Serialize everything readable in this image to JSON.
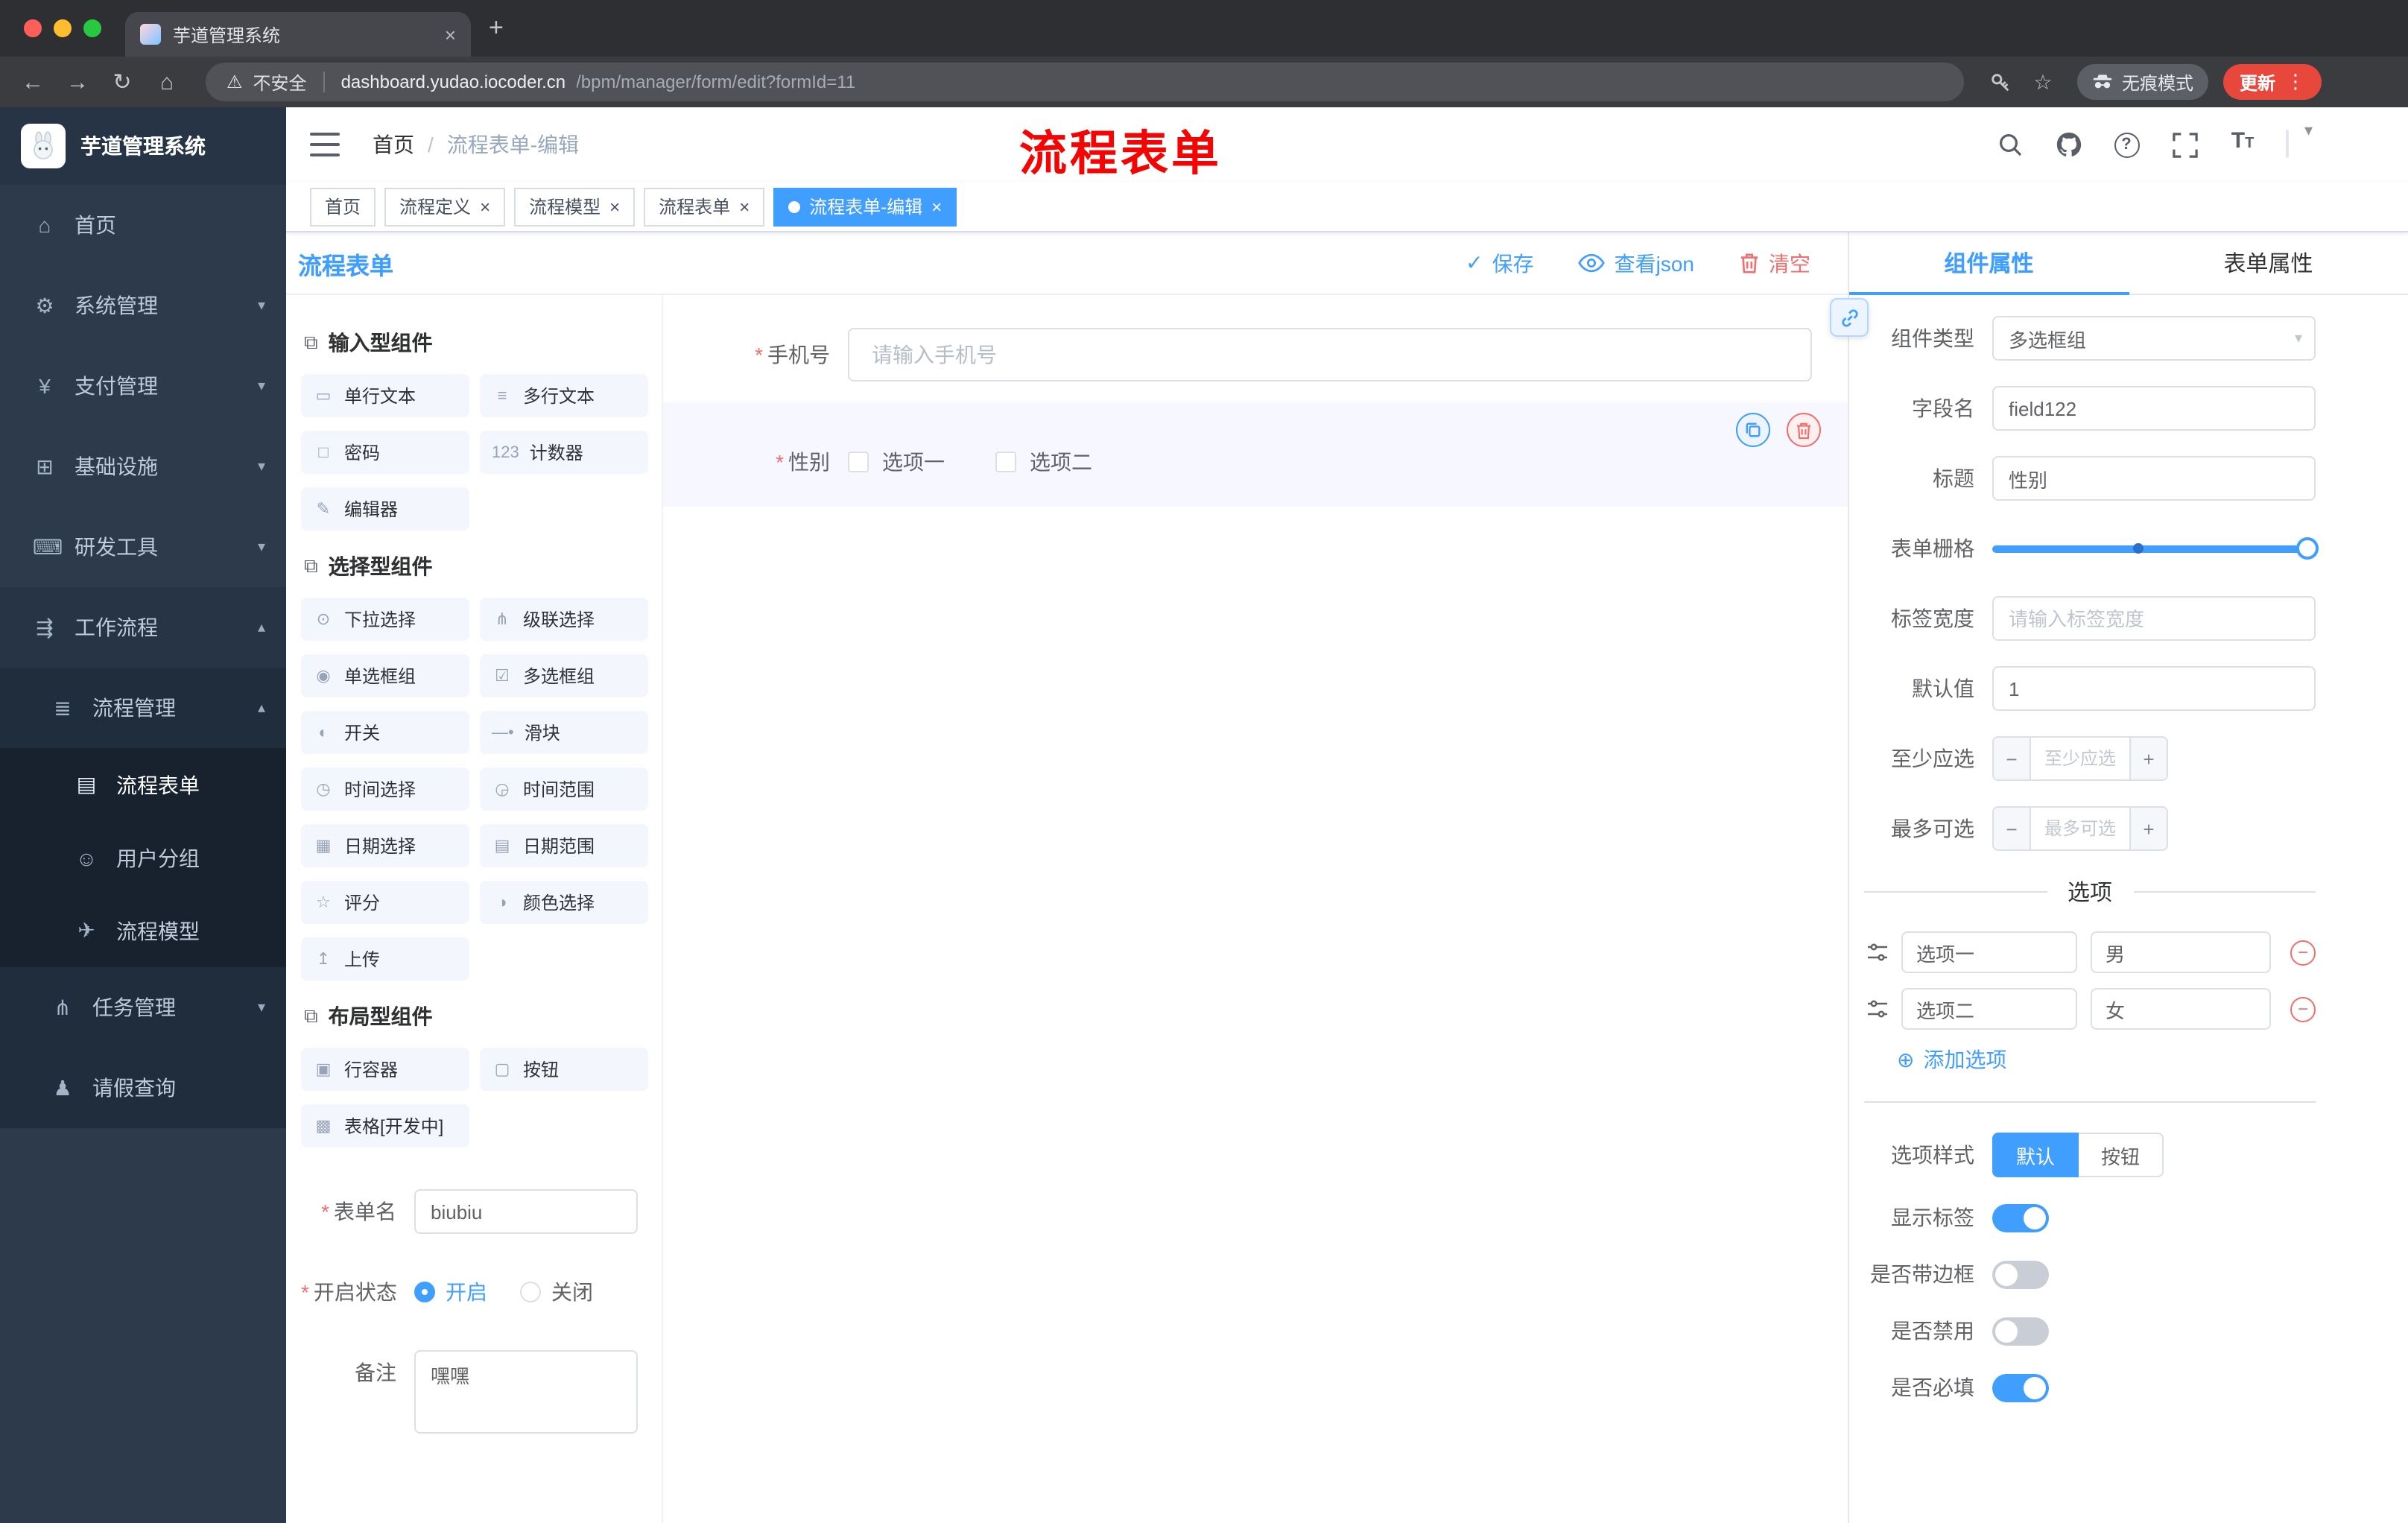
{
  "colors": {
    "primary": "#409eff",
    "danger": "#f56c6c",
    "annotation": "#f40402",
    "sidebar": "#2d3a4b"
  },
  "icons": {
    "close": "×",
    "new_tab": "+",
    "warning": "⚠",
    "back": "←",
    "forward": "→",
    "reload": "↻",
    "home": "⌂",
    "star": "☆",
    "menu_dots": "⋮",
    "caret_down": "▾",
    "caret_up": "▴",
    "check": "✓",
    "circle_plus": "⊕",
    "minus": "−",
    "plus": "+",
    "question": "?",
    "font_size": "T",
    "font_size_small": "T",
    "section": "⧉",
    "dot": "•"
  },
  "browser": {
    "tab_title": "芋道管理系统",
    "security_label": "不安全",
    "url_domain": "dashboard.yudao.iocoder.cn",
    "url_path": "/bpm/manager/form/edit?formId=11",
    "incognito_label": "无痕模式",
    "update_label": "更新"
  },
  "sidebar": {
    "logo_title": "芋道管理系统",
    "items": [
      {
        "label": "首页",
        "icon": "⌂"
      },
      {
        "label": "系统管理",
        "icon": "⚙"
      },
      {
        "label": "支付管理",
        "icon": "¥"
      },
      {
        "label": "基础设施",
        "icon": "⊞"
      },
      {
        "label": "研发工具",
        "icon": "⌨"
      },
      {
        "label": "工作流程",
        "icon": "⇶"
      },
      {
        "label": "流程管理",
        "icon": "≣"
      },
      {
        "label": "流程表单",
        "icon": "▤"
      },
      {
        "label": "用户分组",
        "icon": "☺"
      },
      {
        "label": "流程模型",
        "icon": "✈"
      },
      {
        "label": "任务管理",
        "icon": "⋔"
      },
      {
        "label": "请假查询",
        "icon": "♟"
      }
    ]
  },
  "header": {
    "breadcrumb_home": "首页",
    "breadcrumb_sep": "/",
    "breadcrumb_current": "流程表单-编辑",
    "annotation": "流程表单"
  },
  "tags": [
    {
      "label": "首页"
    },
    {
      "label": "流程定义"
    },
    {
      "label": "流程模型"
    },
    {
      "label": "流程表单"
    },
    {
      "label": "流程表单-编辑"
    }
  ],
  "designer": {
    "title": "流程表单",
    "actions": {
      "save": "保存",
      "view_json": "查看json",
      "clear": "清空"
    },
    "palette": {
      "sections": [
        {
          "title": "输入型组件",
          "items": [
            {
              "label": "单行文本",
              "icon": "▭"
            },
            {
              "label": "多行文本",
              "icon": "≡"
            },
            {
              "label": "密码",
              "icon": "□"
            },
            {
              "label": "计数器",
              "icon": "123"
            },
            {
              "label": "编辑器",
              "icon": "✎"
            }
          ]
        },
        {
          "title": "选择型组件",
          "items": [
            {
              "label": "下拉选择",
              "icon": "⊙"
            },
            {
              "label": "级联选择",
              "icon": "⋔"
            },
            {
              "label": "单选框组",
              "icon": "◉"
            },
            {
              "label": "多选框组",
              "icon": "☑"
            },
            {
              "label": "开关",
              "icon": "◐"
            },
            {
              "label": "滑块",
              "icon": "―•"
            },
            {
              "label": "时间选择",
              "icon": "◷"
            },
            {
              "label": "时间范围",
              "icon": "◶"
            },
            {
              "label": "日期选择",
              "icon": "▦"
            },
            {
              "label": "日期范围",
              "icon": "▤"
            },
            {
              "label": "评分",
              "icon": "☆"
            },
            {
              "label": "颜色选择",
              "icon": "◑"
            },
            {
              "label": "上传",
              "icon": "↥"
            }
          ]
        },
        {
          "title": "布局型组件",
          "items": [
            {
              "label": "行容器",
              "icon": "▣"
            },
            {
              "label": "按钮",
              "icon": "▢"
            },
            {
              "label": "表格[开发中]",
              "icon": "▩"
            }
          ]
        }
      ]
    },
    "meta": {
      "name_label": "表单名",
      "name_value": "biubiu",
      "status_label": "开启状态",
      "status_on": "开启",
      "status_off": "关闭",
      "remark_label": "备注",
      "remark_value": "嘿嘿"
    },
    "canvas": {
      "phone_label": "手机号",
      "phone_placeholder": "请输入手机号",
      "gender_label": "性别",
      "gender_options": [
        {
          "label": "选项一"
        },
        {
          "label": "选项二"
        }
      ]
    }
  },
  "props": {
    "tab_component": "组件属性",
    "tab_form": "表单属性",
    "component_type_label": "组件类型",
    "component_type_value": "多选框组",
    "field_name_label": "字段名",
    "field_name_value": "field122",
    "title_label": "标题",
    "title_value": "性别",
    "grid_label": "表单栅格",
    "label_width_label": "标签宽度",
    "label_width_placeholder": "请输入标签宽度",
    "default_label": "默认值",
    "default_value": "1",
    "min_label": "至少应选",
    "min_placeholder": "至少应选",
    "max_label": "最多可选",
    "max_placeholder": "最多可选",
    "options_title": "选项",
    "options": [
      {
        "name": "选项一",
        "value": "男"
      },
      {
        "name": "选项二",
        "value": "女"
      }
    ],
    "add_option": "添加选项",
    "style_label": "选项样式",
    "style_default": "默认",
    "style_button": "按钮",
    "switch_show_label": "显示标签",
    "switch_border": "是否带边框",
    "switch_disabled": "是否禁用",
    "switch_required": "是否必填"
  }
}
